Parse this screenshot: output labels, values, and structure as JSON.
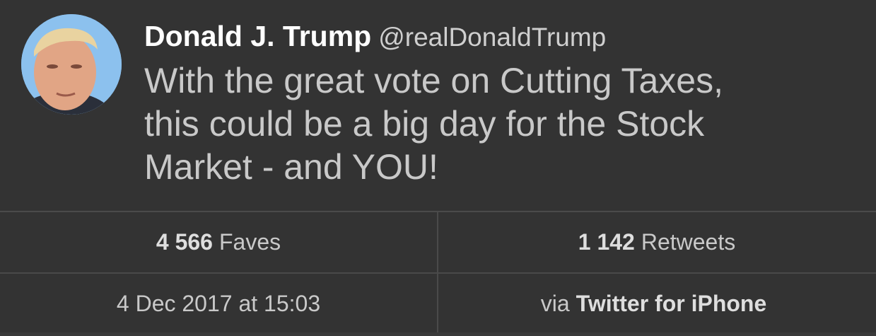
{
  "tweet": {
    "author": {
      "name": "Donald J. Trump",
      "handle": "@realDonaldTrump",
      "avatar": "profile-photo"
    },
    "text_lines": [
      "With the great vote on Cutting Taxes,",
      "this could be a big day for the Stock",
      "Market - and YOU!"
    ]
  },
  "stats": {
    "faves_count": "4 566",
    "faves_label": "Faves",
    "retweets_count": "1 142",
    "retweets_label": "Retweets"
  },
  "meta": {
    "timestamp": "4 Dec 2017 at 15:03",
    "via_label": "via",
    "source": "Twitter for iPhone"
  },
  "colors": {
    "background": "#333333",
    "name_text": "#ffffff",
    "body_text": "#c9c9c9",
    "divider": "#4a4a4a"
  }
}
